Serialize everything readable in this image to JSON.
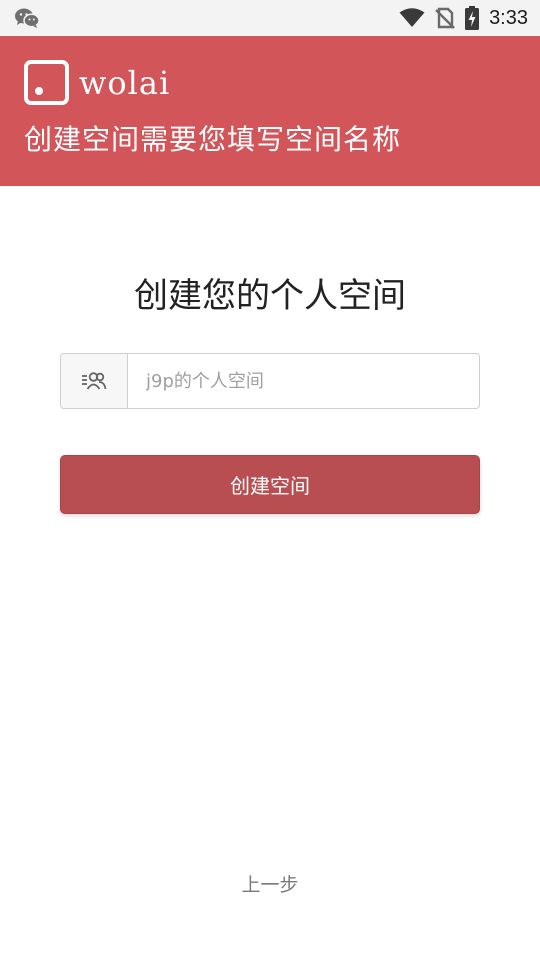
{
  "status_bar": {
    "time": "3:33",
    "icons": [
      "wechat-icon",
      "wifi-icon",
      "no-sim-icon",
      "battery-charging-icon"
    ]
  },
  "header": {
    "brand": "wolai",
    "subtitle": "创建空间需要您填写空间名称",
    "background_color": "#d2555a"
  },
  "main": {
    "title": "创建您的个人空间",
    "space_name_input": {
      "value": "",
      "placeholder": "j9p的个人空间",
      "icon": "team-icon"
    },
    "create_button_label": "创建空间",
    "button_color": "#b84e52"
  },
  "footer": {
    "back_label": "上一步"
  }
}
